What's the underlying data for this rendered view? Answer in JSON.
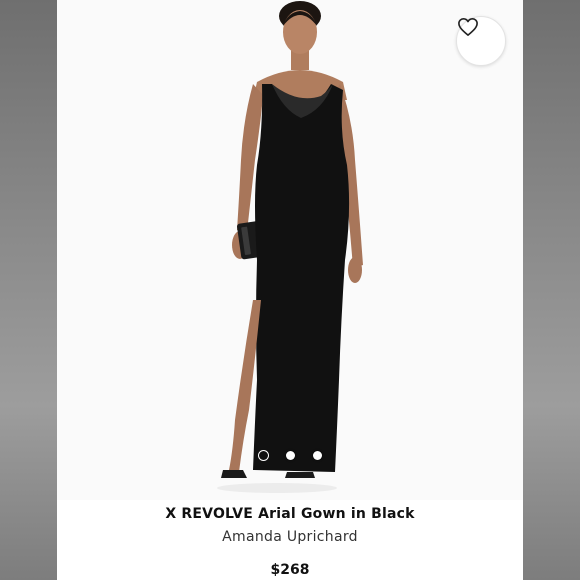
{
  "product": {
    "title": "X REVOLVE Arial Gown in Black",
    "brand": "Amanda Uprichard",
    "price": "$268",
    "image_alt": "model wearing black asymmetric gown with side slit",
    "favorite_icon": "heart-outline-icon",
    "carousel": {
      "total": 3,
      "active": 1
    }
  },
  "colors": {
    "dress": "#111111",
    "background": "#ffffff",
    "side_panels": "#8a8a8a"
  }
}
